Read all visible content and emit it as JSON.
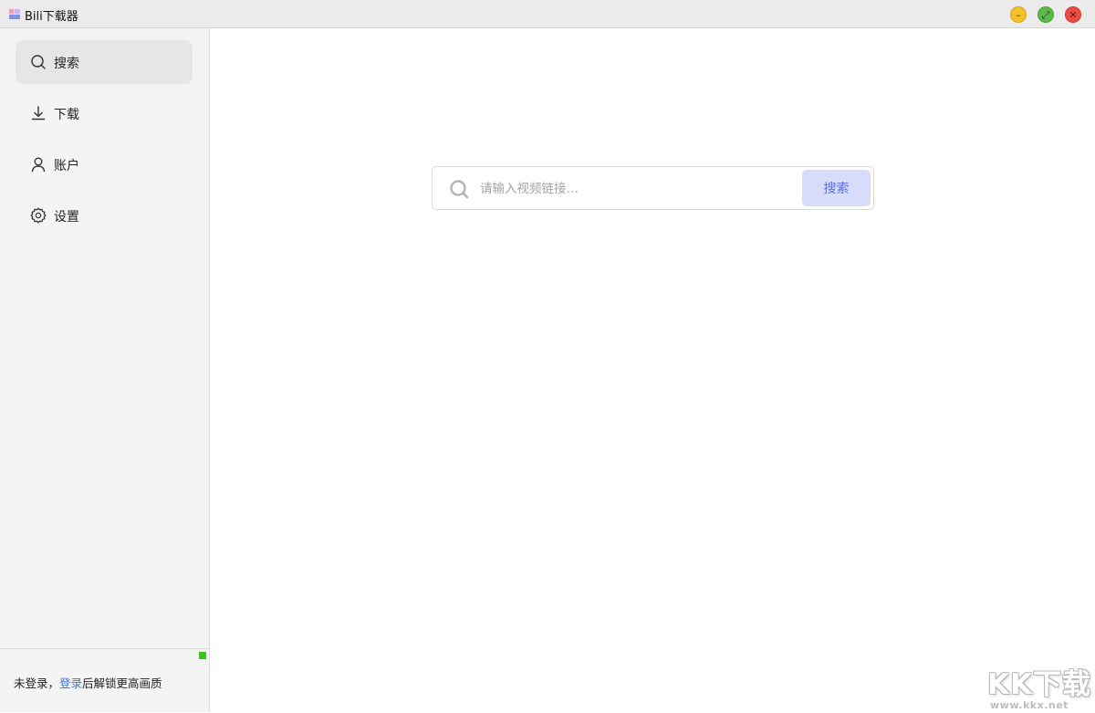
{
  "window": {
    "title": "Bili下载器",
    "icon": "app-icon",
    "controls": {
      "minimize": {
        "glyph": "–",
        "color": "#f5c02a"
      },
      "maximize": {
        "glyph": "⤢",
        "color": "#5cba47"
      },
      "close": {
        "glyph": "✕",
        "color": "#ea4e45"
      }
    }
  },
  "sidebar": {
    "items": [
      {
        "label": "搜索",
        "icon": "search-icon",
        "active": true
      },
      {
        "label": "下载",
        "icon": "download-icon",
        "active": false
      },
      {
        "label": "账户",
        "icon": "user-icon",
        "active": false
      },
      {
        "label": "设置",
        "icon": "gear-icon",
        "active": false
      }
    ],
    "footer": {
      "status_color": "#3ec01f",
      "hint_prefix": "未登录，",
      "login_link": "登录",
      "hint_suffix": "后解锁更高画质"
    }
  },
  "search": {
    "placeholder": "请输入视频链接…",
    "value": "",
    "button_label": "搜索",
    "accent_color": "#5a6ee8"
  },
  "watermark": {
    "logo": "KK下载",
    "url": "www.kkx.net"
  }
}
